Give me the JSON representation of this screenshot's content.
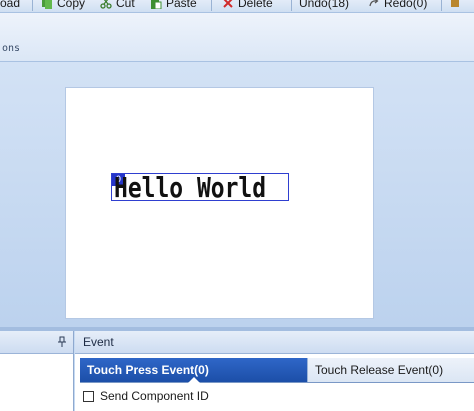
{
  "toolbar": {
    "items": [
      {
        "label": "oad",
        "icon": "load-icon"
      },
      {
        "label": "Copy",
        "icon": "copy-icon"
      },
      {
        "label": "Cut",
        "icon": "cut-icon"
      },
      {
        "label": "Paste",
        "icon": "paste-icon"
      },
      {
        "label": "Delete",
        "icon": "delete-icon"
      },
      {
        "label": "Undo(18)",
        "icon": "undo-icon"
      },
      {
        "label": "Redo(0)",
        "icon": "redo-icon"
      }
    ]
  },
  "ribbon": {
    "group_label": "ons"
  },
  "canvas": {
    "label": {
      "id": "0",
      "text": "Hello World"
    }
  },
  "event_panel": {
    "title": "Event",
    "tabs": [
      {
        "label": "Touch Press Event(0)",
        "active": true
      },
      {
        "label": "Touch Release Event(0)",
        "active": false
      }
    ],
    "send_component_id": {
      "label": "Send Component ID",
      "checked": false
    }
  },
  "colors": {
    "accent": "#1c4fa8",
    "selection_border": "#2f3fd0",
    "workspace": "#c6daf2"
  }
}
